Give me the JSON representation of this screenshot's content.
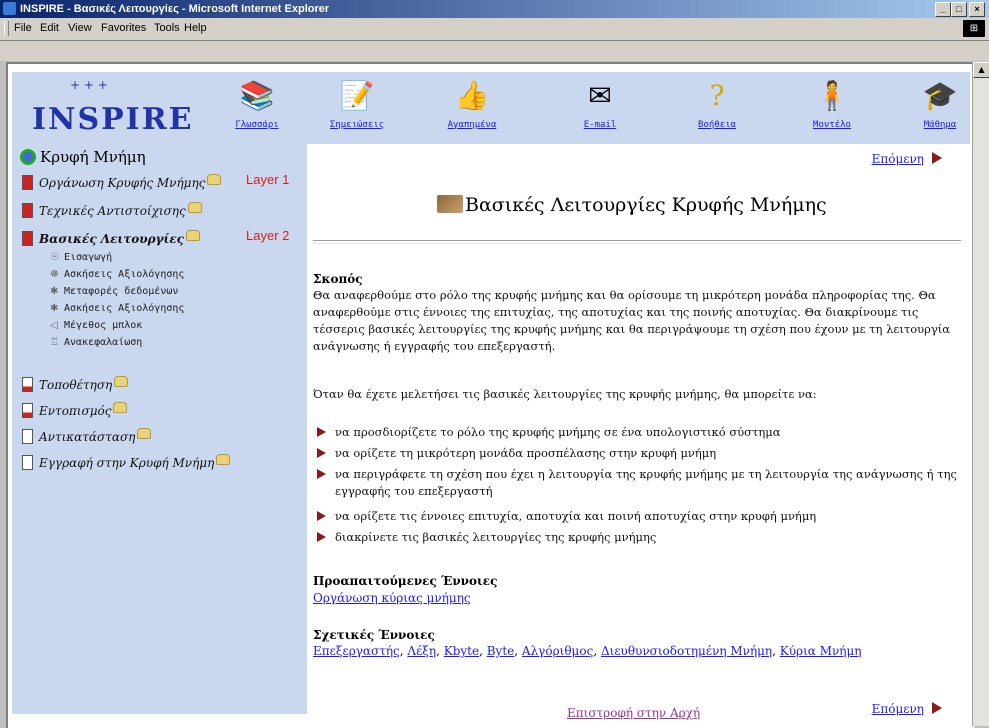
{
  "window": {
    "title": "INSPIRE - Βασικές Λειτουργίες - Microsoft Internet Explorer",
    "min": "_",
    "max": "□",
    "close": "×"
  },
  "menu": [
    "File",
    "Edit",
    "View",
    "Favorites",
    "Tools",
    "Help"
  ],
  "header": {
    "logo": "INSPIRE",
    "nav": [
      {
        "label": "Γλωσσάρι",
        "icon": "glossary-icon",
        "glyph": "📚"
      },
      {
        "label": "Σημειώσεις",
        "icon": "notes-icon",
        "glyph": "📝"
      },
      {
        "label": "Αγαπημένα",
        "icon": "favorites-icon",
        "glyph": "👍"
      },
      {
        "label": "E-mail",
        "icon": "email-icon",
        "glyph": "✉"
      },
      {
        "label": "Βοήθεια",
        "icon": "help-icon",
        "glyph": "?"
      },
      {
        "label": "Μοντέλο",
        "icon": "model-icon",
        "glyph": "🧍"
      },
      {
        "label": "Μάθημα",
        "icon": "lesson-icon",
        "glyph": "🎓"
      }
    ]
  },
  "sidebar": {
    "title": "Κρυφή Μνήμη",
    "items": [
      {
        "label": "Οργάνωση Κρυφής Μνήμης",
        "book": "red",
        "bold": false,
        "layer": "Layer 1"
      },
      {
        "label": "Τεχνικές Αντιστοίχισης",
        "book": "red",
        "bold": false,
        "layer": ""
      },
      {
        "label": "Βασικές Λειτουργίες",
        "book": "red",
        "bold": true,
        "layer": "Layer 2"
      },
      {
        "label": "Τοποθέτηση",
        "book": "half",
        "bold": false,
        "layer": ""
      },
      {
        "label": "Εντοπισμός",
        "book": "half",
        "bold": false,
        "layer": ""
      },
      {
        "label": "Αντικατάσταση",
        "book": "white",
        "bold": false,
        "layer": ""
      },
      {
        "label": "Εγγραφή στην Κρυφή Μνήμη",
        "book": "white",
        "bold": false,
        "layer": ""
      }
    ],
    "subitems": [
      {
        "label": "Εισαγωγή",
        "glyph": "☉"
      },
      {
        "label": "Ασκήσεις Αξιολόγησης",
        "glyph": "☸"
      },
      {
        "label": "Μεταφορές δεδομένων",
        "glyph": "✱"
      },
      {
        "label": "Ασκήσεις Αξιολόγησης",
        "glyph": "✱"
      },
      {
        "label": "Μέγεθος μπλοκ",
        "glyph": "◁"
      },
      {
        "label": "Ανακεφαλαίωση",
        "glyph": "♖"
      }
    ]
  },
  "content": {
    "next_label": "Επόμενη",
    "title": "Βασικές Λειτουργίες Κρυφής Μνήμης",
    "purpose_heading": "Σκοπός",
    "purpose_text": "Θα αναφερθούμε στο ρόλο της κρυφής μνήμης και θα ορίσουμε τη μικρότερη μονάδα πληροφορίας της. Θα αναφερθούμε στις έννοιες της επιτυχίας, της αποτυχίας και της ποινής αποτυχίας. Θα διακρίνουμε τις τέσσερις βασικές λειτουργίες της κρυφής μνήμης και θα περιγράψουμε τη σχέση που έχουν με τη λειτουργία ανάγνωσης ή εγγραφής του επεξεργαστή.",
    "intro_text": "Όταν θα έχετε μελετήσει τις βασικές λειτουργίες της κρυφής μνήμης, θα μπορείτε να:",
    "bullets": [
      "να προσδιορίζετε το ρόλο της κρυφής μνήμης σε ένα υπολογιστικό σύστημα",
      "να ορίζετε τη μικρότερη μονάδα προσπέλασης στην κρυφή μνήμη",
      "να περιγράφετε τη σχέση που έχει η λειτουργία της κρυφής μνήμης με τη λειτουργία της ανάγνωσης ή της εγγραφής του επεξεργαστή",
      "να ορίζετε τις έννοιες επιτυχία, αποτυχία και ποινή αποτυχίας στην κρυφή μνήμη",
      "διακρίνετε τις βασικές λειτουργίες της κρυφής μνήμης"
    ],
    "prereq_heading": "Προαπαιτούμενες Έννοιες",
    "prereq_link": "Οργάνωση κύριας μνήμης",
    "related_heading": "Σχετικές Έννοιες",
    "related_links": [
      "Επεξεργαστής",
      "Λέξη",
      "Kbyte",
      "Byte",
      "Αλγόριθμος",
      "Διευθυνσιοδοτημένη Μνήμη",
      "Κύρια Μνήμη"
    ],
    "home_label": "Επιστροφή στην Αρχή",
    "next_bottom_label": "Επόμενη"
  }
}
